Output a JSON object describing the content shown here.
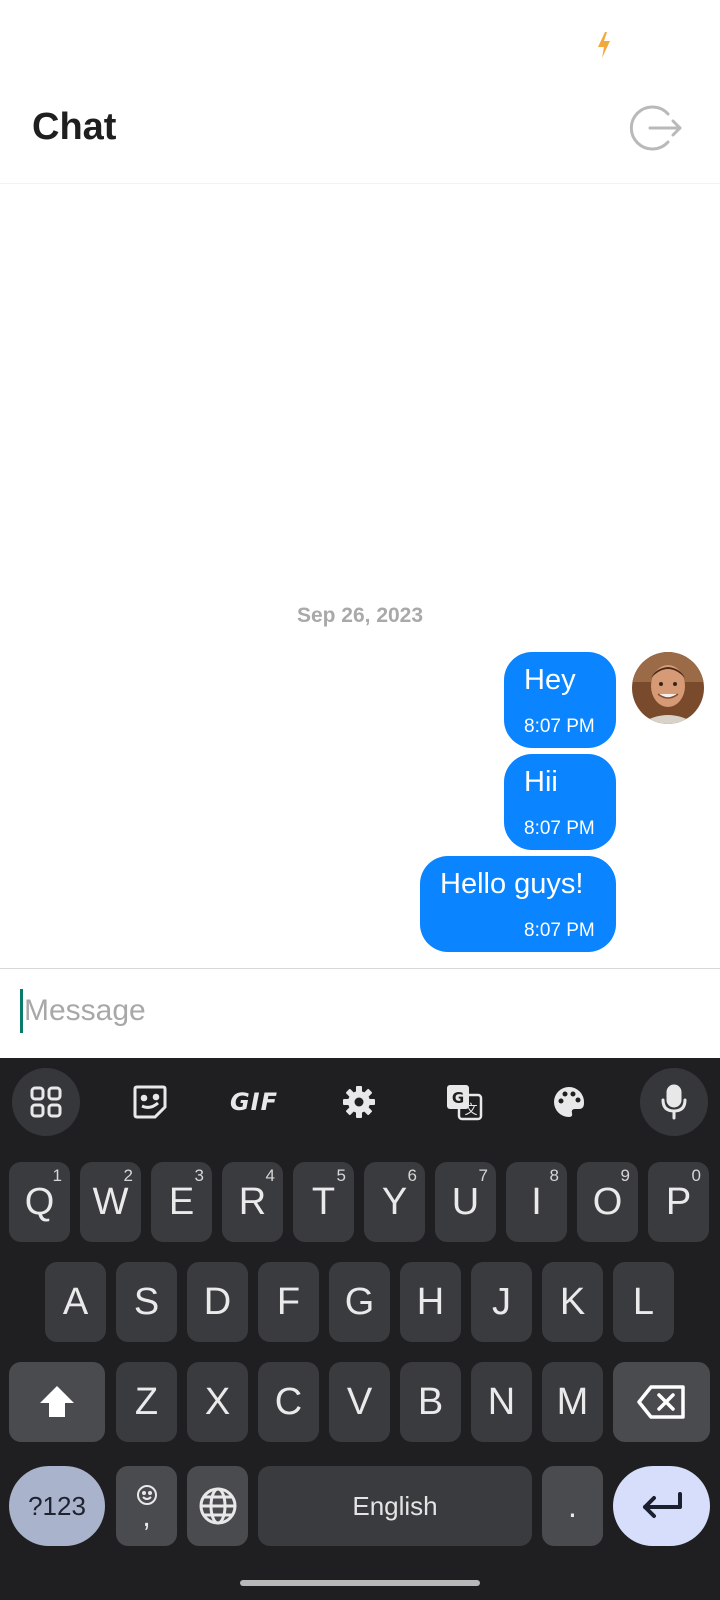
{
  "header": {
    "title": "Chat",
    "logout_icon": "logout-icon"
  },
  "status_bar": {
    "icon": "flash-icon",
    "icon_color": "#f2a93b"
  },
  "chat": {
    "date_separator": "Sep 26, 2023",
    "bubble_color": "#0a84ff",
    "messages": [
      {
        "text": "Hey",
        "time": "8:07 PM"
      },
      {
        "text": "Hii",
        "time": "8:07 PM"
      },
      {
        "text": "Hello guys!",
        "time": "8:07 PM"
      }
    ]
  },
  "composer": {
    "placeholder": "Message"
  },
  "keyboard": {
    "toolbar": [
      "apps-grid-icon",
      "sticker-icon",
      "GIF",
      "gear-icon",
      "translate-icon",
      "palette-icon",
      "mic-icon"
    ],
    "row1": [
      {
        "label": "Q",
        "hint": "1"
      },
      {
        "label": "W",
        "hint": "2"
      },
      {
        "label": "E",
        "hint": "3"
      },
      {
        "label": "R",
        "hint": "4"
      },
      {
        "label": "T",
        "hint": "5"
      },
      {
        "label": "Y",
        "hint": "6"
      },
      {
        "label": "U",
        "hint": "7"
      },
      {
        "label": "I",
        "hint": "8"
      },
      {
        "label": "O",
        "hint": "9"
      },
      {
        "label": "P",
        "hint": "0"
      }
    ],
    "row2": [
      "A",
      "S",
      "D",
      "F",
      "G",
      "H",
      "J",
      "K",
      "L"
    ],
    "row3": [
      "Z",
      "X",
      "C",
      "V",
      "B",
      "N",
      "M"
    ],
    "symbols_label": "?123",
    "comma_label": ",",
    "space_label": "English",
    "period_label": "."
  }
}
